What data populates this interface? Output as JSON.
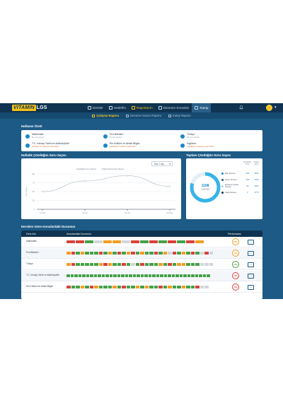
{
  "brand": {
    "logo_part1": "VITAMIN",
    "logo_part2": "LGS",
    "accent": "#f4c21b",
    "primary": "#1d5a86",
    "dark": "#0f3350"
  },
  "nav": {
    "items": [
      {
        "label": "Dersler",
        "icon": "book-icon"
      },
      {
        "label": "Hedefim",
        "icon": "target-icon"
      },
      {
        "label": "Raporlarım",
        "icon": "chart-icon"
      },
      {
        "label": "Deneme Sınavları",
        "icon": "exam-icon"
      },
      {
        "label": "Kamp",
        "icon": "tent-icon"
      }
    ],
    "active_index": 2,
    "highlight_index": 4
  },
  "subnav": {
    "items": [
      {
        "label": "Çalışma Raporu",
        "icon": "report-icon"
      },
      {
        "label": "Deneme Sınavı Raporu",
        "icon": "exam-report-icon"
      },
      {
        "label": "Kamp Raporu",
        "icon": "camp-report-icon"
      }
    ],
    "active_index": 0
  },
  "summary": {
    "title": "Haftanın Özeti",
    "items": [
      {
        "title": "Matematik",
        "status": "İlk sıra çalıştın",
        "warn": false
      },
      {
        "title": "Fen Bilimleri",
        "status": "İlk sıra çalıştın",
        "warn": false
      },
      {
        "title": "Türkçe",
        "status": "İlk sıra çalıştın",
        "warn": false
      },
      {
        "title": "T.C. İnkılap Tarihi ve Atatürkçülük",
        "status": "Haftalığı bir çalışma yapmadın",
        "warn": true
      },
      {
        "title": "Din Kültürü ve Ahlak Bilgisi",
        "status": "Haftalığı bir çalışma yapmadın",
        "warn": true
      },
      {
        "title": "İngilizce",
        "status": "Haftalığı bir çalışma yapmadın",
        "warn": true
      }
    ]
  },
  "weekly": {
    "title": "Haftalık Çözdüğün Soru Sayısı",
    "select_value": "Son 1 Ay",
    "legend": [
      "Çözdüğün Soru Sayısı",
      "Doğru/Yanlış Soru Sayısı"
    ]
  },
  "chart_data": {
    "type": "line",
    "categories": [
      "12 Nis",
      "19 Nis",
      "26 Nis",
      "03 May"
    ],
    "series": [
      {
        "name": "Çözdüğün Soru Sayısı",
        "values": [
          50,
          80,
          95,
          65
        ]
      }
    ],
    "y_ticks": [
      "0",
      "25",
      "50",
      "75",
      "100"
    ],
    "ylim": [
      0,
      100
    ],
    "ylabel": "Soru Sayısı",
    "grid": true
  },
  "total": {
    "title": "Toplam Çözdüğün Soru Sayısı",
    "value": "1108",
    "out_of": "/ 20742",
    "headers": [
      "Çözdüğün Soru",
      "Toplam Soru"
    ],
    "rows": [
      {
        "label": "Etüt Sorusu",
        "v1": "684",
        "v2": "8436",
        "color": "#1a86c7"
      },
      {
        "label": "Yazılı Sorusu",
        "v1": "368",
        "v2": "6925",
        "color": "#1d5a86"
      },
      {
        "label": "Deneme Sınavı Sorusu",
        "v1": "56",
        "v2": "1602",
        "color": "#a4d8f0"
      },
      {
        "label": "Kitap Sorusu",
        "v1": "0",
        "v2": "3779",
        "color": "#0f3350"
      }
    ]
  },
  "topics": {
    "title": "Derslere Göre Konulardaki Durumun",
    "col_name": "Ders Adı",
    "col_status": "Konulardaki Durumun",
    "col_perf": "Performans",
    "colors": {
      "r": "#d9403a",
      "o": "#f39c1f",
      "g": "#43a047",
      "x": "#d0d6dc"
    },
    "rows": [
      {
        "name": "Matematik",
        "pattern": "rrgxooxrgrgrgro",
        "widths": "wide",
        "perf": "65%",
        "perf_color": "#f39c1f"
      },
      {
        "name": "Fen Bilimleri",
        "pattern": "orgogggrgogrgorgoggrgoxrgogrgxrx",
        "widths": "narrow",
        "perf": "56%",
        "perf_color": "#f39c1f"
      },
      {
        "name": "Türkçe",
        "pattern": "orgggggoroggrgxgrgggogrgoogggxxx",
        "widths": "narrow",
        "perf": "74%",
        "perf_color": "#43a047"
      },
      {
        "name": "T.C. İnkılap Tarihi ve Atatürkçülük",
        "pattern": "ggggggggggggggggggggggggggggggggggggg",
        "widths": "tiny",
        "perf": "75%",
        "perf_color": "#d9403a"
      },
      {
        "name": "Din Kültürü ve Ahlak Bilgisi",
        "pattern": "rggogrogggogrggogoggrgoggoggrxx",
        "widths": "narrow",
        "perf": "72%",
        "perf_color": "#d9403a"
      }
    ]
  }
}
